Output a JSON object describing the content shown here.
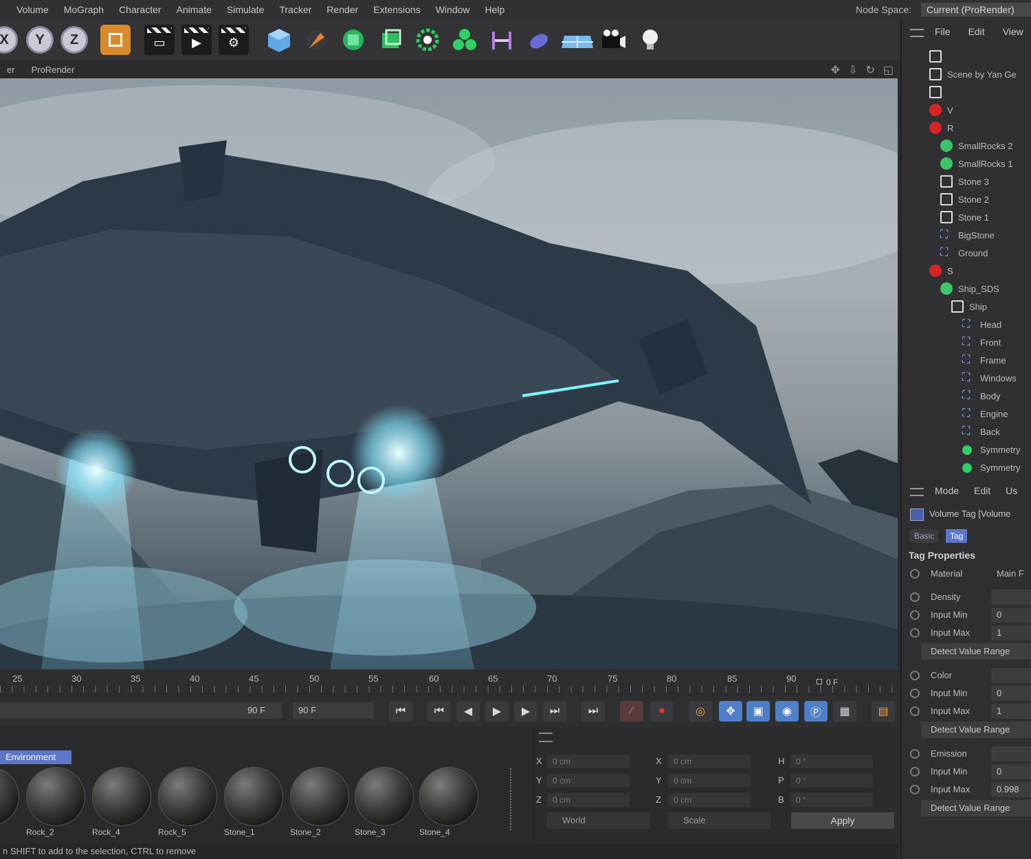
{
  "menubar": {
    "items": [
      "Volume",
      "MoGraph",
      "Character",
      "Animate",
      "Simulate",
      "Tracker",
      "Render",
      "Extensions",
      "Window",
      "Help"
    ],
    "node_space_label": "Node Space:",
    "node_space_value": "Current (ProRender)"
  },
  "toolbar": {
    "axes": [
      "X",
      "Y",
      "Z"
    ]
  },
  "viewport": {
    "menu": [
      "er",
      "ProRender"
    ]
  },
  "timeline": {
    "ticks": [
      "25",
      "30",
      "35",
      "40",
      "45",
      "50",
      "55",
      "60",
      "65",
      "70",
      "75",
      "80",
      "85",
      "90"
    ],
    "current_frame_label": "0 F",
    "end_field": "90 F",
    "max_field": "90 F"
  },
  "materials": {
    "filter_tab": "Environment",
    "items": [
      "Rock_2",
      "Rock_4",
      "Rock_5",
      "Stone_1",
      "Stone_2",
      "Stone_3",
      "Stone_4"
    ]
  },
  "coordinates": {
    "rows": [
      {
        "a": "X",
        "a_val": "0 cm",
        "b": "X",
        "b_val": "0 cm",
        "c": "H",
        "c_val": "0 °"
      },
      {
        "a": "Y",
        "a_val": "0 cm",
        "b": "Y",
        "b_val": "0 cm",
        "c": "P",
        "c_val": "0 °"
      },
      {
        "a": "Z",
        "a_val": "0 cm",
        "b": "Z",
        "b_val": "0 cm",
        "c": "B",
        "c_val": "0 °"
      }
    ],
    "space": "World",
    "mode": "Scale",
    "apply": "Apply"
  },
  "status": {
    "text": "n SHIFT to add to the selection, CTRL to remove"
  },
  "object_manager": {
    "menu": [
      "File",
      "Edit",
      "View"
    ],
    "rows": [
      {
        "label": "",
        "icon": "null",
        "indent": 0
      },
      {
        "label": "Scene by Yan Ge",
        "icon": "null",
        "indent": 0
      },
      {
        "label": "",
        "icon": "null",
        "indent": 0
      },
      {
        "label": "V",
        "icon": "warn",
        "indent": 0
      },
      {
        "label": "R",
        "icon": "warn",
        "indent": 0
      },
      {
        "label": "SmallRocks 2",
        "icon": "gear",
        "indent": 1
      },
      {
        "label": "SmallRocks 1",
        "icon": "gear",
        "indent": 1
      },
      {
        "label": "Stone 3",
        "icon": "null",
        "indent": 1
      },
      {
        "label": "Stone 2",
        "icon": "null",
        "indent": 1
      },
      {
        "label": "Stone 1",
        "icon": "null",
        "indent": 1
      },
      {
        "label": "BigStone",
        "icon": "figure",
        "indent": 1
      },
      {
        "label": "Ground",
        "icon": "figure",
        "indent": 1
      },
      {
        "label": "S",
        "icon": "warn",
        "indent": 0
      },
      {
        "label": "Ship_SDS",
        "icon": "gear",
        "indent": 1
      },
      {
        "label": "Ship",
        "icon": "null",
        "indent": 2
      },
      {
        "label": "Head",
        "icon": "figure",
        "indent": 3
      },
      {
        "label": "Front",
        "icon": "figure",
        "indent": 3
      },
      {
        "label": "Frame",
        "icon": "figure",
        "indent": 3
      },
      {
        "label": "Windows",
        "icon": "figure",
        "indent": 3
      },
      {
        "label": "Body",
        "icon": "figure",
        "indent": 3
      },
      {
        "label": "Engine",
        "icon": "figure",
        "indent": 3
      },
      {
        "label": "Back",
        "icon": "figure",
        "indent": 3
      },
      {
        "label": "Symmetry",
        "icon": "green",
        "indent": 3
      },
      {
        "label": "Symmetry",
        "icon": "green",
        "indent": 3
      }
    ]
  },
  "attribute_manager": {
    "menu": [
      "Mode",
      "Edit",
      "Us"
    ],
    "title": "Volume Tag [Volume",
    "tabs": {
      "basic": "Basic",
      "tag": "Tag"
    },
    "section": "Tag Properties",
    "material_label": "Material",
    "material_value": "Main F",
    "rows": [
      {
        "label": "Density",
        "value": ""
      },
      {
        "label": "Input Min",
        "value": "0"
      },
      {
        "label": "Input Max",
        "value": "1"
      },
      {
        "label": "Color",
        "value": ""
      },
      {
        "label": "Input Min",
        "value": "0"
      },
      {
        "label": "Input Max",
        "value": "1"
      },
      {
        "label": "Emission",
        "value": ""
      },
      {
        "label": "Input Min",
        "value": "0"
      },
      {
        "label": "Input Max",
        "value": "0.998"
      }
    ],
    "detect_button": "Detect Value Range"
  }
}
